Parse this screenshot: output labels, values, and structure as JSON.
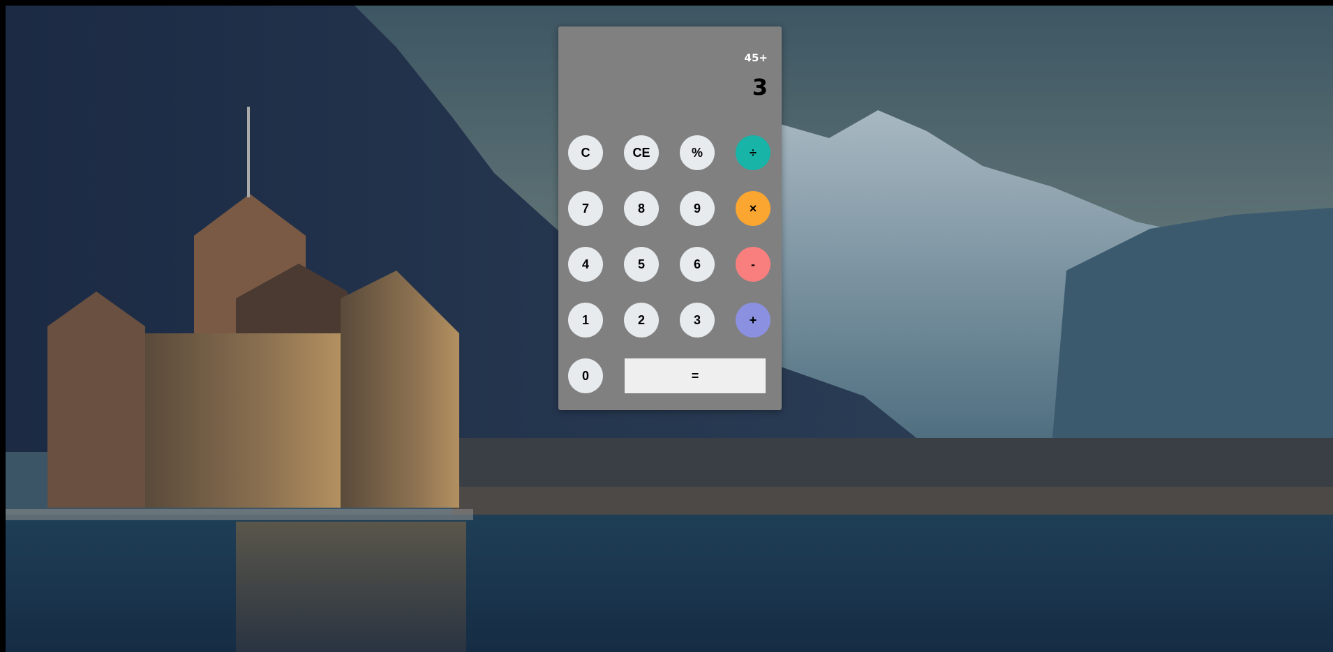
{
  "display": {
    "history": "45+",
    "result": "3"
  },
  "buttons": {
    "clear": "C",
    "clear_entry": "CE",
    "percent": "%",
    "divide": "÷",
    "seven": "7",
    "eight": "8",
    "nine": "9",
    "multiply": "×",
    "four": "4",
    "five": "5",
    "six": "6",
    "subtract": "-",
    "one": "1",
    "two": "2",
    "three": "3",
    "add": "+",
    "zero": "0",
    "equals": "="
  },
  "colors": {
    "calculator_body": "#808080",
    "number_button": "#e7ebee",
    "divide_button": "#17b4a7",
    "multiply_button": "#fba631",
    "subtract_button": "#f97f7e",
    "add_button": "#8b91e0",
    "equals_button": "#efefef"
  }
}
